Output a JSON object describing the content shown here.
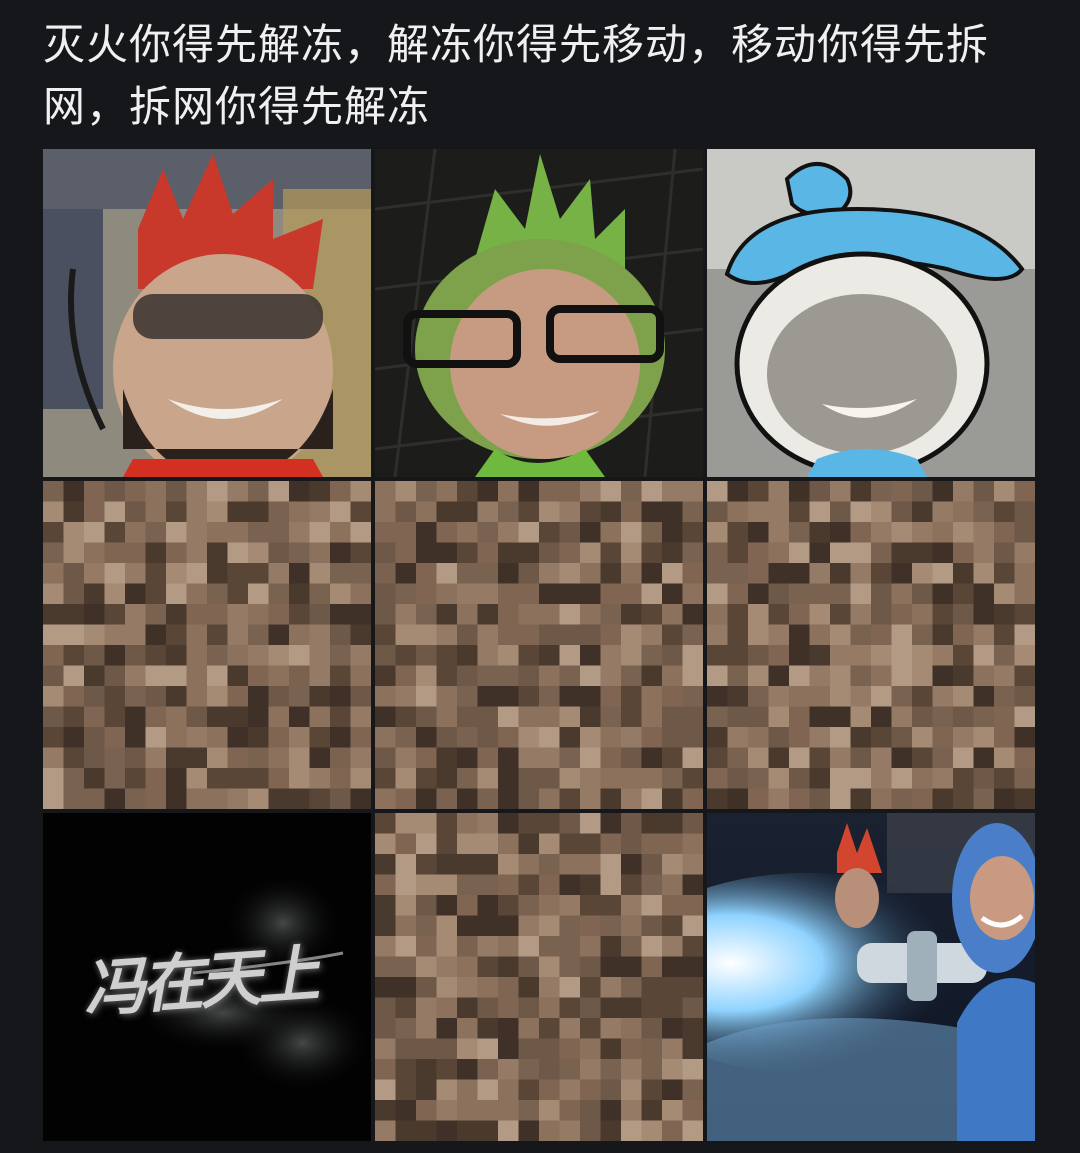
{
  "post": {
    "text": "灭火你得先解冻，解冻你得先移动，移动你得先拆网，拆网你得先解冻"
  },
  "grid": {
    "images": [
      {
        "name": "red-fire-character-face",
        "kind": "photo"
      },
      {
        "name": "green-onion-character-face",
        "kind": "photo"
      },
      {
        "name": "blue-water-character-face",
        "kind": "photo"
      },
      {
        "name": "pixelated-image",
        "kind": "mosaic"
      },
      {
        "name": "pixelated-image",
        "kind": "mosaic"
      },
      {
        "name": "pixelated-image",
        "kind": "mosaic"
      },
      {
        "name": "calligraphy-title-card",
        "kind": "title",
        "text": "冯在天上"
      },
      {
        "name": "pixelated-image",
        "kind": "mosaic"
      },
      {
        "name": "blue-character-ice-blaster-scene",
        "kind": "photo"
      }
    ]
  },
  "colors": {
    "background": "#16171a",
    "text": "#f0f0f0",
    "mosaic_base": "#6e5848"
  }
}
